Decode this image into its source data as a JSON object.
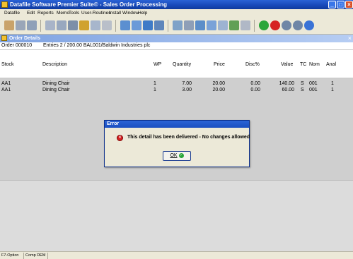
{
  "window": {
    "title": "Datafile Software Premier Suite© - Sales Order Processing"
  },
  "menu": [
    "Datafile",
    "Edit",
    "Reports",
    "Memo",
    "Tools",
    "User-Routines",
    "Install",
    "Window",
    "Help"
  ],
  "child": {
    "title": "Order Details",
    "order_line": "Order 000010",
    "entries": "Entries  2 / 200.00  BAL001/Baldwin Industries plc"
  },
  "columns": {
    "stock": "Stock",
    "description": "Description",
    "wp": "WP",
    "quantity": "Quantity",
    "price": "Price",
    "disc": "Disc%",
    "value": "Value",
    "tc": "TC",
    "nom": "Nom",
    "anal": "Anal"
  },
  "rows": [
    {
      "stock": "AA1",
      "description": "Dining Chair",
      "wp": "1",
      "quantity": "7.00",
      "price": "20.00",
      "disc": "0.00",
      "value": "140.00",
      "tc": "S",
      "nom": "001",
      "anal": "1"
    },
    {
      "stock": "AA1",
      "description": "Dining Chair",
      "wp": "1",
      "quantity": "3.00",
      "price": "20.00",
      "disc": "0.00",
      "value": "60.00",
      "tc": "S",
      "nom": "001",
      "anal": "1"
    }
  ],
  "dialog": {
    "title": "Error",
    "message": "This detail has been delivered - No changes allowed",
    "ok_label": "OK"
  },
  "status": {
    "f7": "F7-Option",
    "comp": "Comp DEM"
  },
  "colors": {
    "titlebar": "#1748b8",
    "grid_bg": "#cfcfcf",
    "error_icon": "#d62222",
    "ok_icon": "#2aa63a"
  }
}
